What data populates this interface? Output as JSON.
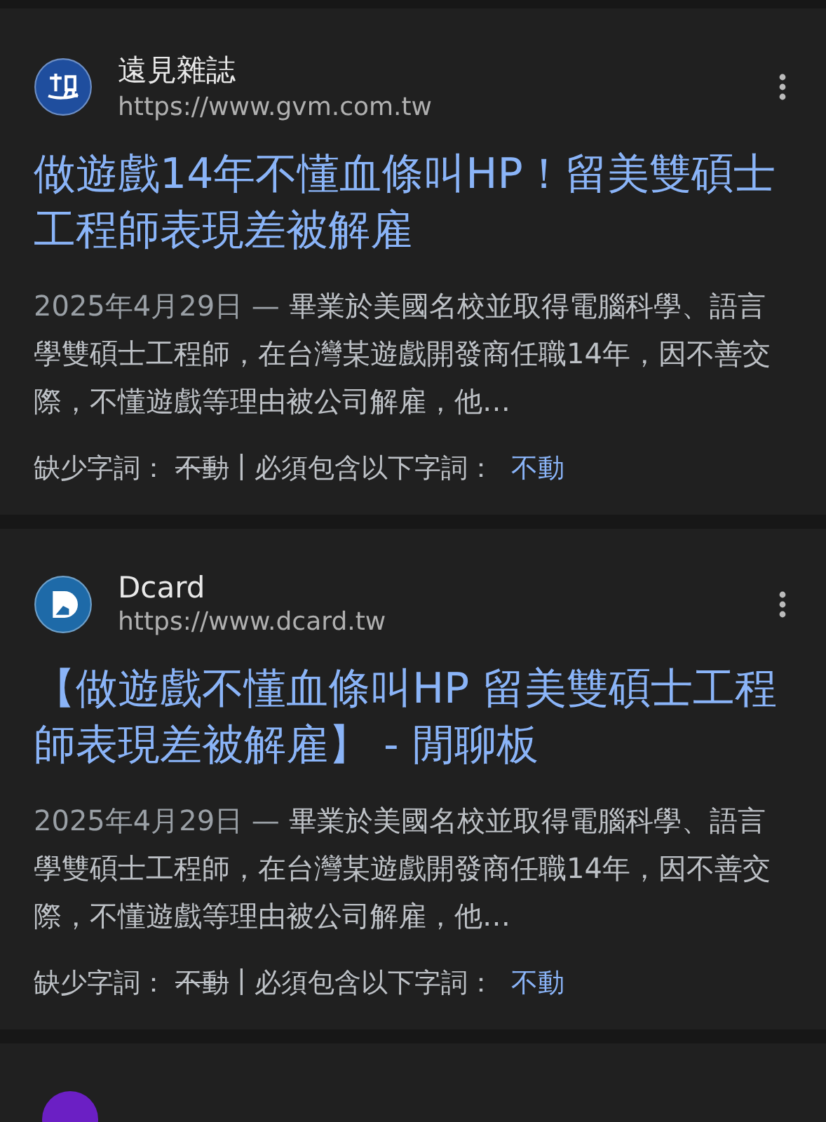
{
  "results": [
    {
      "site": "遠見雜誌",
      "url": "https://www.gvm.com.tw",
      "kind": "gvm",
      "title": "做遊戲14年不懂血條叫HP！留美雙碩士工程師表現差被解雇",
      "date": "2025年4月29日",
      "dash": "—",
      "snippet": "畢業於美國名校並取得電腦科學、語言學雙碩士工程師，在台灣某遊戲開發商任職14年，因不善交際，不懂遊戲等理由被公司解雇，他…",
      "missing_label": "缺少字詞：",
      "missing_term": "不動",
      "separator": "|",
      "must_label": "必須包含以下字詞：",
      "must_term": "不動"
    },
    {
      "site": "Dcard",
      "url": "https://www.dcard.tw",
      "kind": "dcard",
      "title": "【做遊戲不懂血條叫HP 留美雙碩士工程師表現差被解雇】 - 閒聊板",
      "date": "2025年4月29日",
      "dash": "—",
      "snippet": "畢業於美國名校並取得電腦科學、語言學雙碩士工程師，在台灣某遊戲開發商任職14年，因不善交際，不懂遊戲等理由被公司解雇，他…",
      "missing_label": "缺少字詞：",
      "missing_term": "不動",
      "separator": "|",
      "must_label": "必須包含以下字詞：",
      "must_term": "不動"
    }
  ],
  "next_card": {
    "kind": "purple"
  }
}
